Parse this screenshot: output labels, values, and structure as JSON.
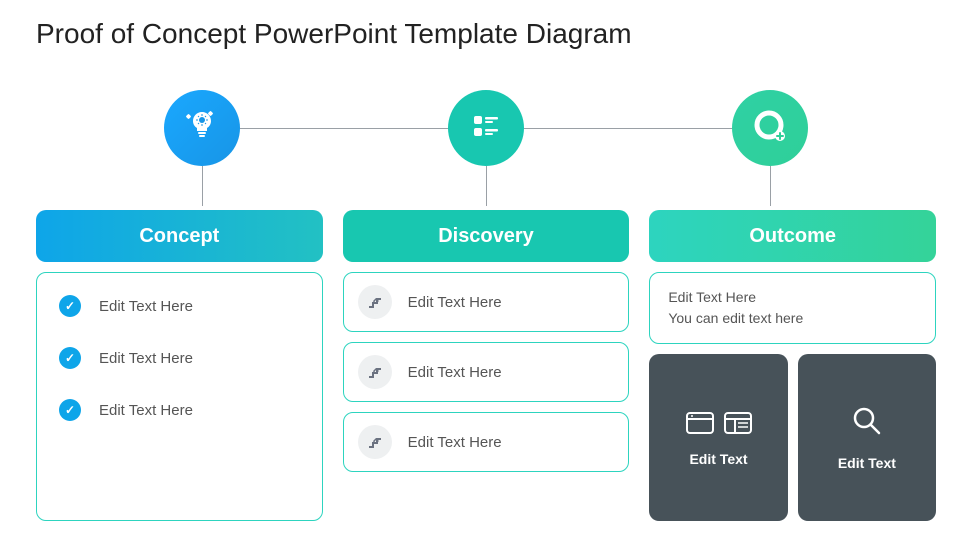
{
  "title": "Proof of Concept PowerPoint Template Diagram",
  "columns": {
    "concept": {
      "header": "Concept",
      "items": [
        "Edit Text Here",
        "Edit Text Here",
        "Edit Text Here"
      ]
    },
    "discovery": {
      "header": "Discovery",
      "items": [
        "Edit Text Here",
        "Edit Text Here",
        "Edit Text Here"
      ]
    },
    "outcome": {
      "header": "Outcome",
      "top_line1": "Edit Text Here",
      "top_line2": "You can edit text here",
      "card1": "Edit Text",
      "card2": "Edit Text"
    }
  },
  "colors": {
    "concept": "#0ea5e9",
    "discovery": "#18c7b0",
    "outcome": "#2dd4bf",
    "card_bg": "#475259"
  }
}
